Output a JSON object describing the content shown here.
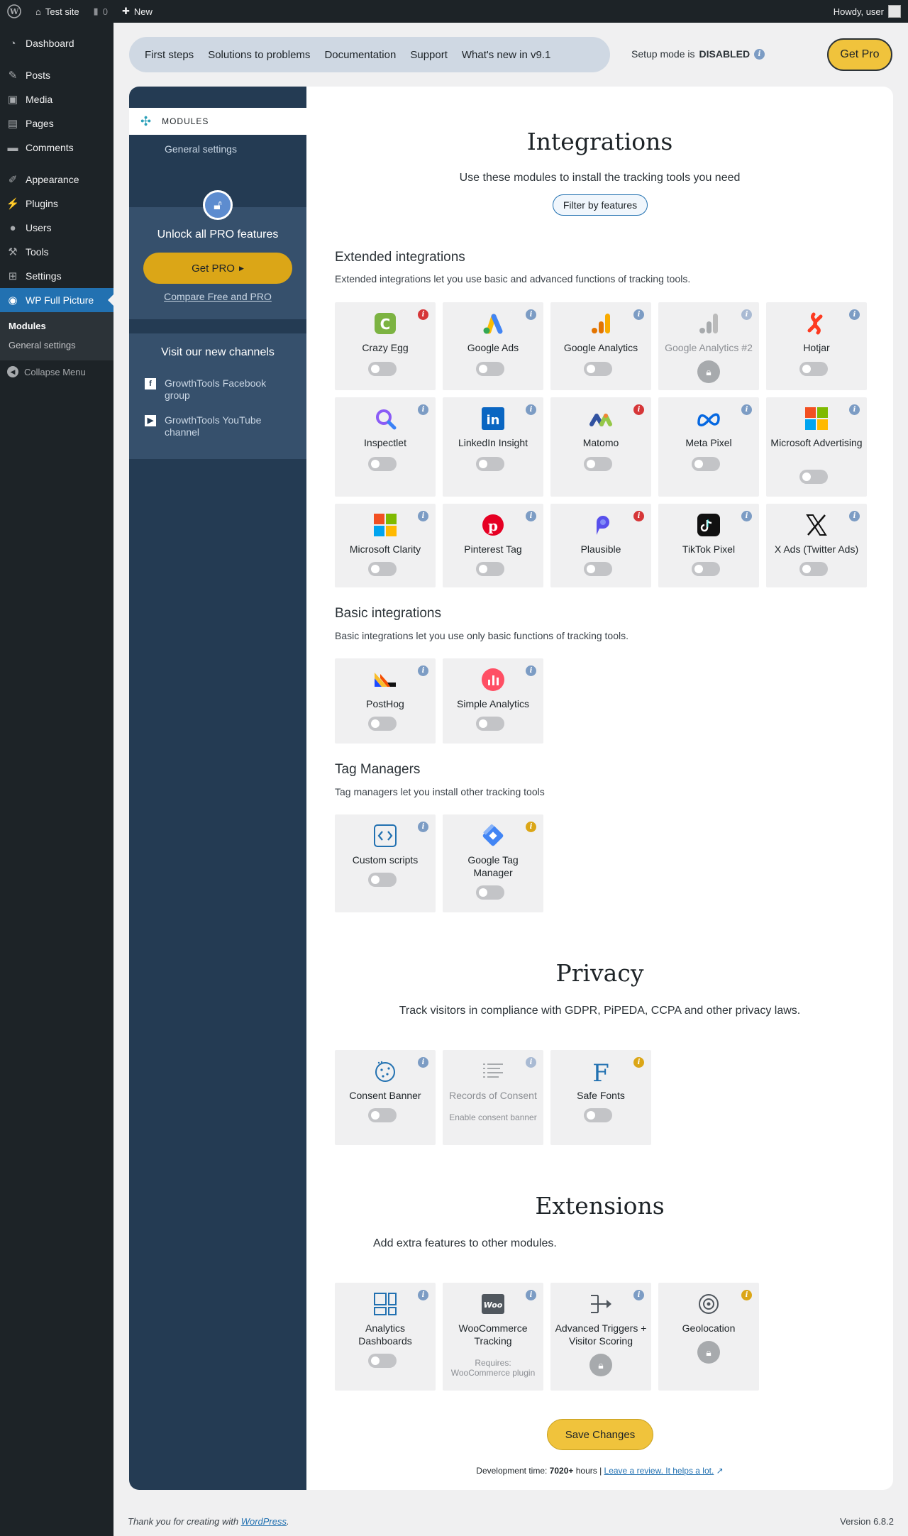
{
  "adminbar": {
    "site_name": "Test site",
    "comments_count": "0",
    "new_label": "New",
    "greeting": "Howdy, user"
  },
  "menu": {
    "items": [
      {
        "label": "Dashboard",
        "icon": "dashboard-icon"
      },
      {
        "label": "Posts",
        "icon": "pin-icon"
      },
      {
        "label": "Media",
        "icon": "media-icon"
      },
      {
        "label": "Pages",
        "icon": "pages-icon"
      },
      {
        "label": "Comments",
        "icon": "comment-icon"
      },
      {
        "label": "Appearance",
        "icon": "brush-icon"
      },
      {
        "label": "Plugins",
        "icon": "plug-icon"
      },
      {
        "label": "Users",
        "icon": "user-icon"
      },
      {
        "label": "Tools",
        "icon": "wrench-icon"
      },
      {
        "label": "Settings",
        "icon": "settings-icon"
      },
      {
        "label": "WP Full Picture",
        "icon": "chart-icon"
      }
    ],
    "submenu": [
      "Modules",
      "General settings"
    ],
    "collapse": "Collapse Menu"
  },
  "topnav": {
    "links": [
      "First steps",
      "Solutions to problems",
      "Documentation",
      "Support",
      "What's new in v9.1"
    ],
    "setup_mode_label": "Setup mode is",
    "setup_mode_value": "DISABLED",
    "get_pro": "Get Pro"
  },
  "plugin_sidebar": {
    "tab": "MODULES",
    "sub": "General settings",
    "pro_title": "Unlock all PRO features",
    "pro_button": "Get PRO",
    "compare": "Compare Free and PRO",
    "channels_title": "Visit our new channels",
    "channels": [
      "GrowthTools Facebook group",
      "GrowthTools YouTube channel"
    ]
  },
  "integrations": {
    "title": "Integrations",
    "subtitle": "Use these modules to install the tracking tools you need",
    "filter": "Filter by features",
    "extended": {
      "title": "Extended integrations",
      "desc": "Extended integrations let you use basic and advanced functions of tracking tools.",
      "cards": [
        "Crazy Egg",
        "Google Ads",
        "Google Analytics",
        "Google Analytics #2",
        "Hotjar",
        "Inspectlet",
        "LinkedIn Insight",
        "Matomo",
        "Meta Pixel",
        "Microsoft Advertising",
        "Microsoft Clarity",
        "Pinterest Tag",
        "Plausible",
        "TikTok Pixel",
        "X Ads (Twitter Ads)"
      ]
    },
    "basic": {
      "title": "Basic integrations",
      "desc": "Basic integrations let you use only basic functions of tracking tools.",
      "cards": [
        "PostHog",
        "Simple Analytics"
      ]
    },
    "tag_managers": {
      "title": "Tag Managers",
      "desc": "Tag managers let you install other tracking tools",
      "cards": [
        "Custom scripts",
        "Google Tag Manager"
      ]
    }
  },
  "privacy": {
    "title": "Privacy",
    "subtitle": "Track visitors in compliance with GDPR, PiPEDA, CCPA and other privacy laws.",
    "cards": [
      "Consent Banner",
      "Records of Consent",
      "Safe Fonts"
    ],
    "records_note": "Enable consent banner"
  },
  "extensions": {
    "title": "Extensions",
    "subtitle": "Add extra features to other modules.",
    "cards": [
      "Analytics Dashboards",
      "WooCommerce Tracking",
      "Advanced Triggers + Visitor Scoring",
      "Geolocation"
    ],
    "woo_note": "Requires: WooCommerce plugin"
  },
  "save": "Save Changes",
  "devtime": {
    "prefix": "Development time:",
    "hours": "7020+",
    "suffix": "hours |",
    "review": "Leave a review. It helps a lot."
  },
  "footer": {
    "thanks": "Thank you for creating with",
    "wp": "WordPress",
    "version": "Version 6.8.2"
  }
}
